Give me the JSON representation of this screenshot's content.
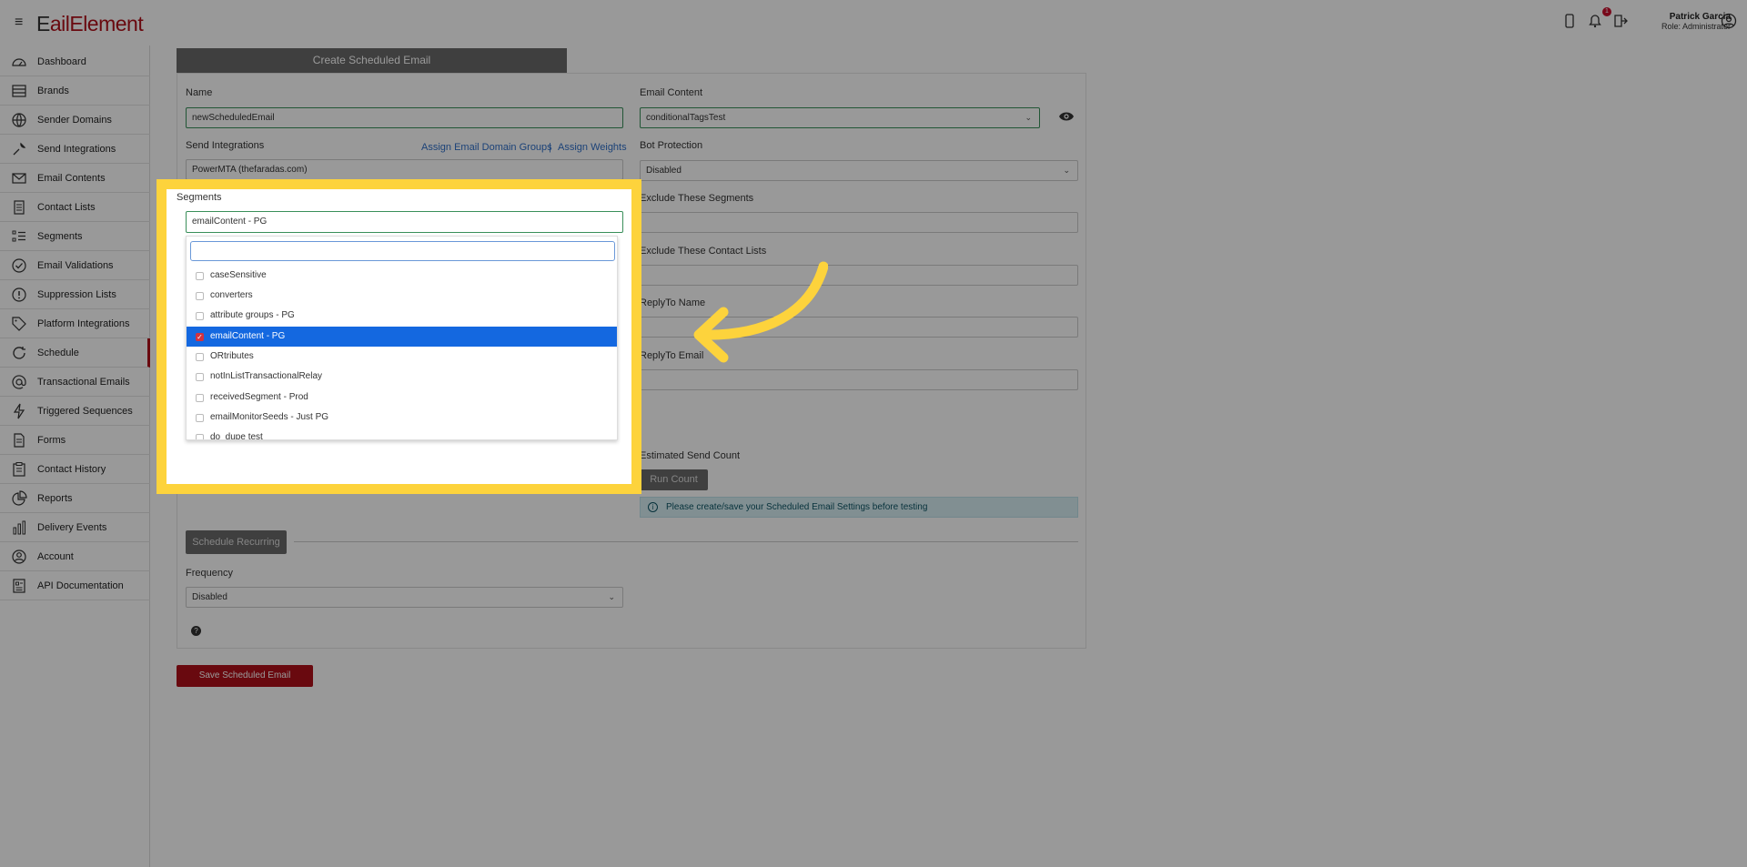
{
  "app": {
    "logo_prefix": "E",
    "logo_text": "ailElement",
    "user_name": "Patrick Garcia",
    "user_role": "Role: Administrator",
    "notification_count": "1"
  },
  "sidebar": {
    "items": [
      {
        "label": "Dashboard",
        "icon": "dashboard-icon"
      },
      {
        "label": "Brands",
        "icon": "brands-icon"
      },
      {
        "label": "Sender Domains",
        "icon": "globe-icon"
      },
      {
        "label": "Send Integrations",
        "icon": "wrench-icon"
      },
      {
        "label": "Email Contents",
        "icon": "envelope-icon"
      },
      {
        "label": "Contact Lists",
        "icon": "document-icon"
      },
      {
        "label": "Segments",
        "icon": "list-icon"
      },
      {
        "label": "Email Validations",
        "icon": "check-circle-icon"
      },
      {
        "label": "Suppression Lists",
        "icon": "alert-circle-icon"
      },
      {
        "label": "Platform Integrations",
        "icon": "tag-icon"
      },
      {
        "label": "Schedule",
        "icon": "schedule-icon"
      },
      {
        "label": "Transactional Emails",
        "icon": "at-icon"
      },
      {
        "label": "Triggered Sequences",
        "icon": "lightning-icon"
      },
      {
        "label": "Forms",
        "icon": "form-icon"
      },
      {
        "label": "Contact History",
        "icon": "clipboard-icon"
      },
      {
        "label": "Reports",
        "icon": "pie-chart-icon"
      },
      {
        "label": "Delivery Events",
        "icon": "bar-chart-icon"
      },
      {
        "label": "Account",
        "icon": "user-circle-icon"
      },
      {
        "label": "API Documentation",
        "icon": "api-doc-icon"
      }
    ]
  },
  "form": {
    "tab_title": "Create Scheduled Email",
    "name_label": "Name",
    "name_value": "newScheduledEmail",
    "email_content_label": "Email Content",
    "email_content_value": "conditionalTagsTest",
    "send_integrations_label": "Send Integrations",
    "assign_groups_link": "Assign Email Domain Groups",
    "link_separator": "|",
    "assign_weights_link": "Assign Weights",
    "send_integrations_value": "PowerMTA (thefaradas.com)",
    "bot_protection_label": "Bot Protection",
    "bot_protection_value": "Disabled",
    "exclude_segments_label": "Exclude These Segments",
    "exclude_lists_label": "Exclude These Contact Lists",
    "reply_to_name_label": "ReplyTo Name",
    "reply_to_email_label": "ReplyTo Email",
    "estimated_label": "Estimated Send Count",
    "run_count_button": "Run Count",
    "info_message": "Please create/save your Scheduled Email Settings before testing",
    "schedule_recurring_button": "Schedule Recurring",
    "frequency_label": "Frequency",
    "frequency_value": "Disabled",
    "help_icon": "?",
    "save_button": "Save Scheduled Email"
  },
  "segments": {
    "label": "Segments",
    "selected_value": "emailContent - PG",
    "search_placeholder": "",
    "options": [
      {
        "label": "caseSensitive",
        "checked": false
      },
      {
        "label": "converters",
        "checked": false
      },
      {
        "label": "attribute groups - PG",
        "checked": false
      },
      {
        "label": "emailContent - PG",
        "checked": true
      },
      {
        "label": "ORtributes",
        "checked": false
      },
      {
        "label": "notInListTransactionalRelay",
        "checked": false
      },
      {
        "label": "receivedSegment - Prod",
        "checked": false
      },
      {
        "label": "emailMonitorSeeds - Just PG",
        "checked": false
      },
      {
        "label": "do_dupe test",
        "checked": false
      }
    ]
  },
  "colors": {
    "brand": "#b0101a",
    "highlight": "#fdd33c",
    "selected_option": "#1468e0"
  }
}
